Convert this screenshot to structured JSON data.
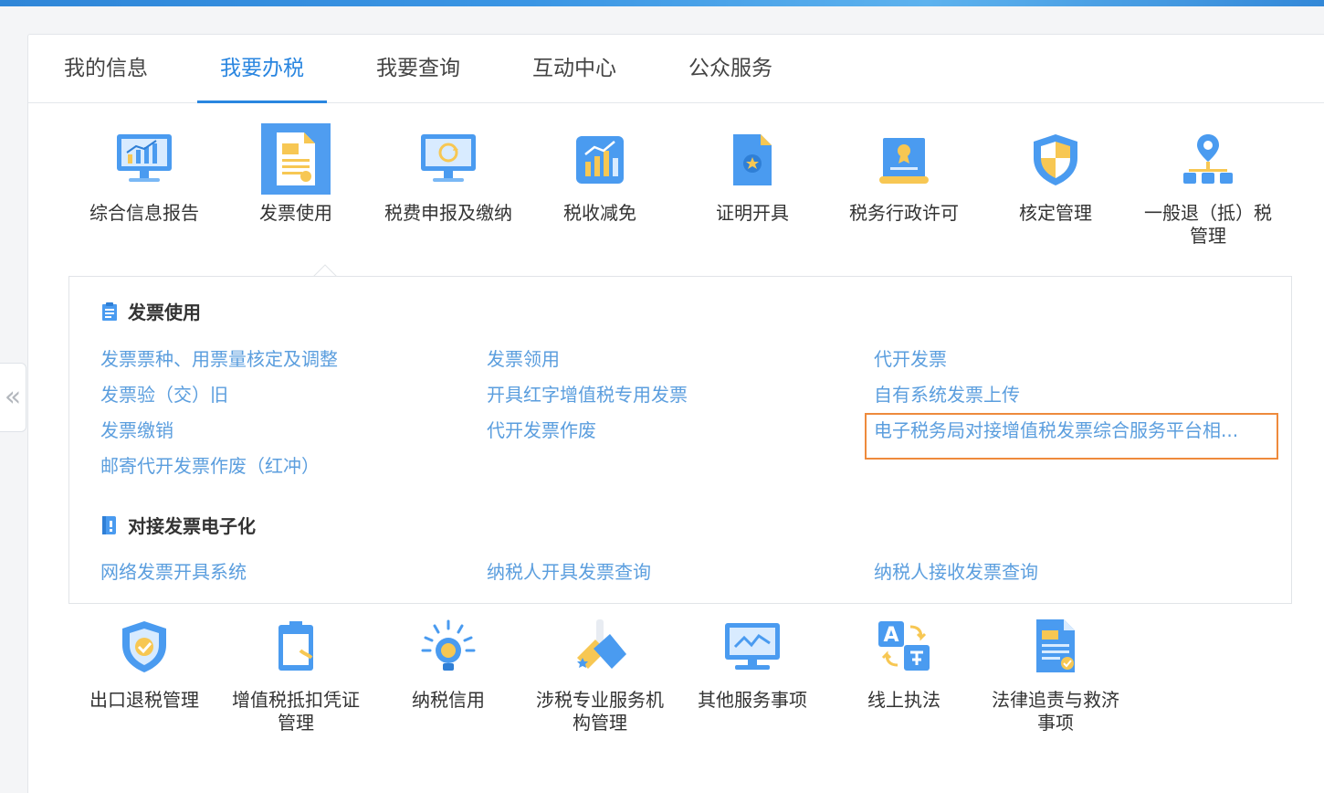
{
  "tabs": [
    {
      "label": "我的信息"
    },
    {
      "label": "我要办税",
      "active": true
    },
    {
      "label": "我要查询"
    },
    {
      "label": "互动中心"
    },
    {
      "label": "公众服务"
    }
  ],
  "collapse_glyph": "«",
  "services_top": [
    {
      "label": "综合信息报告",
      "icon": "monitor-chart-icon"
    },
    {
      "label": "发票使用",
      "icon": "invoice-document-icon",
      "selected": true
    },
    {
      "label": "税费申报及缴纳",
      "icon": "monitor-refresh-icon"
    },
    {
      "label": "税收减免",
      "icon": "bar-chart-icon"
    },
    {
      "label": "证明开具",
      "icon": "certificate-document-icon"
    },
    {
      "label": "税务行政许可",
      "icon": "license-award-icon"
    },
    {
      "label": "核定管理",
      "icon": "shield-icon"
    },
    {
      "label": "一般退（抵）税",
      "label2": "管理",
      "icon": "location-network-icon"
    }
  ],
  "popup": {
    "sections": [
      {
        "title": "发票使用",
        "icon": "clipboard-icon",
        "links": [
          "发票票种、用票量核定及调整",
          "发票领用",
          "代开发票",
          "发票验（交）旧",
          "开具红字增值税专用发票",
          "自有系统发票上传",
          "发票缴销",
          "代开发票作废",
          "电子税务局对接增值税发票综合服务平台相...",
          "邮寄代开发票作废（红冲）"
        ]
      },
      {
        "title": "对接发票电子化",
        "icon": "book-icon",
        "links": [
          "网络发票开具系统",
          "纳税人开具发票查询",
          "纳税人接收发票查询"
        ]
      }
    ]
  },
  "services_bottom": [
    {
      "label": "出口退税管理",
      "icon": "shield-check-icon"
    },
    {
      "label": "增值税抵扣凭证",
      "label2": "管理",
      "icon": "voucher-document-icon"
    },
    {
      "label": "纳税信用",
      "icon": "lightbulb-icon"
    },
    {
      "label": "涉税专业服务机",
      "label2": "构管理",
      "icon": "tools-icon"
    },
    {
      "label": "其他服务事项",
      "icon": "monitor-line-icon"
    },
    {
      "label": "线上执法",
      "icon": "translate-icon"
    },
    {
      "label": "法律追责与救济",
      "label2": "事项",
      "icon": "legal-document-icon"
    }
  ],
  "colors": {
    "accent": "#2a86e0",
    "link": "#5b9ede",
    "highlight_border": "#ee8a3c",
    "icon_blue": "#4a9bf0",
    "icon_yellow": "#f7c753"
  }
}
